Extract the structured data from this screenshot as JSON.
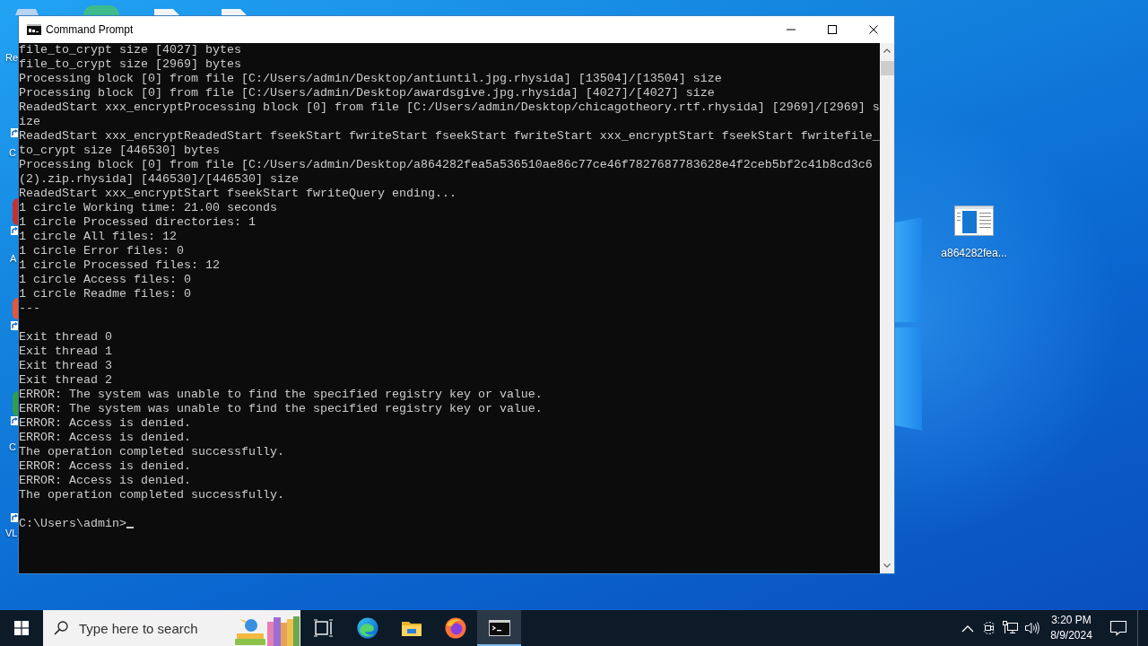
{
  "window": {
    "title": "Command Prompt"
  },
  "console": {
    "blocks": [
      [
        "file_to_crypt size [4027] bytes",
        "file_to_crypt size [2969] bytes",
        "Processing block [0] from file [C:/Users/admin/Desktop/antiuntil.jpg.rhysida] [13504]/[13504] size",
        "Processing block [0] from file [C:/Users/admin/Desktop/awardsgive.jpg.rhysida] [4027]/[4027] size",
        "ReadedStart xxx_encryptProcessing block [0] from file [C:/Users/admin/Desktop/chicagotheory.rtf.rhysida] [2969]/[2969] s",
        "ize",
        "ReadedStart xxx_encryptReadedStart fseekStart fwriteStart fseekStart fwriteStart xxx_encryptStart fseekStart fwritefile_",
        "to_crypt size [446530] bytes",
        "Processing block [0] from file [C:/Users/admin/Desktop/a864282fea5a536510ae86c77ce46f7827687783628e4f2ceb5bf2c41b8cd3c6",
        "(2).zip.rhysida] [446530]/[446530] size",
        "ReadedStart xxx_encryptStart fseekStart fwriteQuery ending...",
        "1 circle Working time: 21.00 seconds",
        "1 circle Processed directories: 1",
        "1 circle All files: 12",
        "1 circle Error files: 0",
        "1 circle Processed files: 12",
        "1 circle Access files: 0",
        "1 circle Readme files: 0",
        "---"
      ],
      [
        "Exit thread 0",
        "Exit thread 1",
        "Exit thread 3",
        "Exit thread 2",
        "ERROR: The system was unable to find the specified registry key or value.",
        "ERROR: The system was unable to find the specified registry key or value.",
        "ERROR: Access is denied.",
        "ERROR: Access is denied.",
        "The operation completed successfully.",
        "ERROR: Access is denied.",
        "ERROR: Access is denied.",
        "The operation completed successfully."
      ]
    ],
    "prompt": "C:\\Users\\admin>",
    "cursor": true
  },
  "desktop": {
    "top_icons": [
      {
        "kind": "circle",
        "color": "#3dbb8c"
      },
      {
        "kind": "file"
      },
      {
        "kind": "file"
      }
    ],
    "column_icons": [
      {
        "kind": "bin",
        "label": "Re"
      },
      {
        "kind": "shortcut",
        "label": "C"
      },
      {
        "kind": "shortcut",
        "label": "A",
        "color": "#c8302f"
      },
      {
        "kind": "shortcut",
        "color": "#e8553a"
      },
      {
        "kind": "shortcut",
        "label": "C",
        "color": "#2e9d4e"
      },
      {
        "kind": "shortcut",
        "label": "VL"
      }
    ],
    "icons": [
      {
        "label": "a864282fea..."
      }
    ]
  },
  "taskbar": {
    "search": {
      "placeholder": "Type here to search"
    },
    "apps": [
      {
        "kind": "taskview",
        "active": false
      },
      {
        "kind": "edge",
        "active": false
      },
      {
        "kind": "explorer",
        "active": false
      },
      {
        "kind": "firefox",
        "active": false
      },
      {
        "kind": "terminal",
        "active": true
      }
    ],
    "clock": {
      "time": "3:20 PM",
      "date": "8/9/2024"
    }
  }
}
